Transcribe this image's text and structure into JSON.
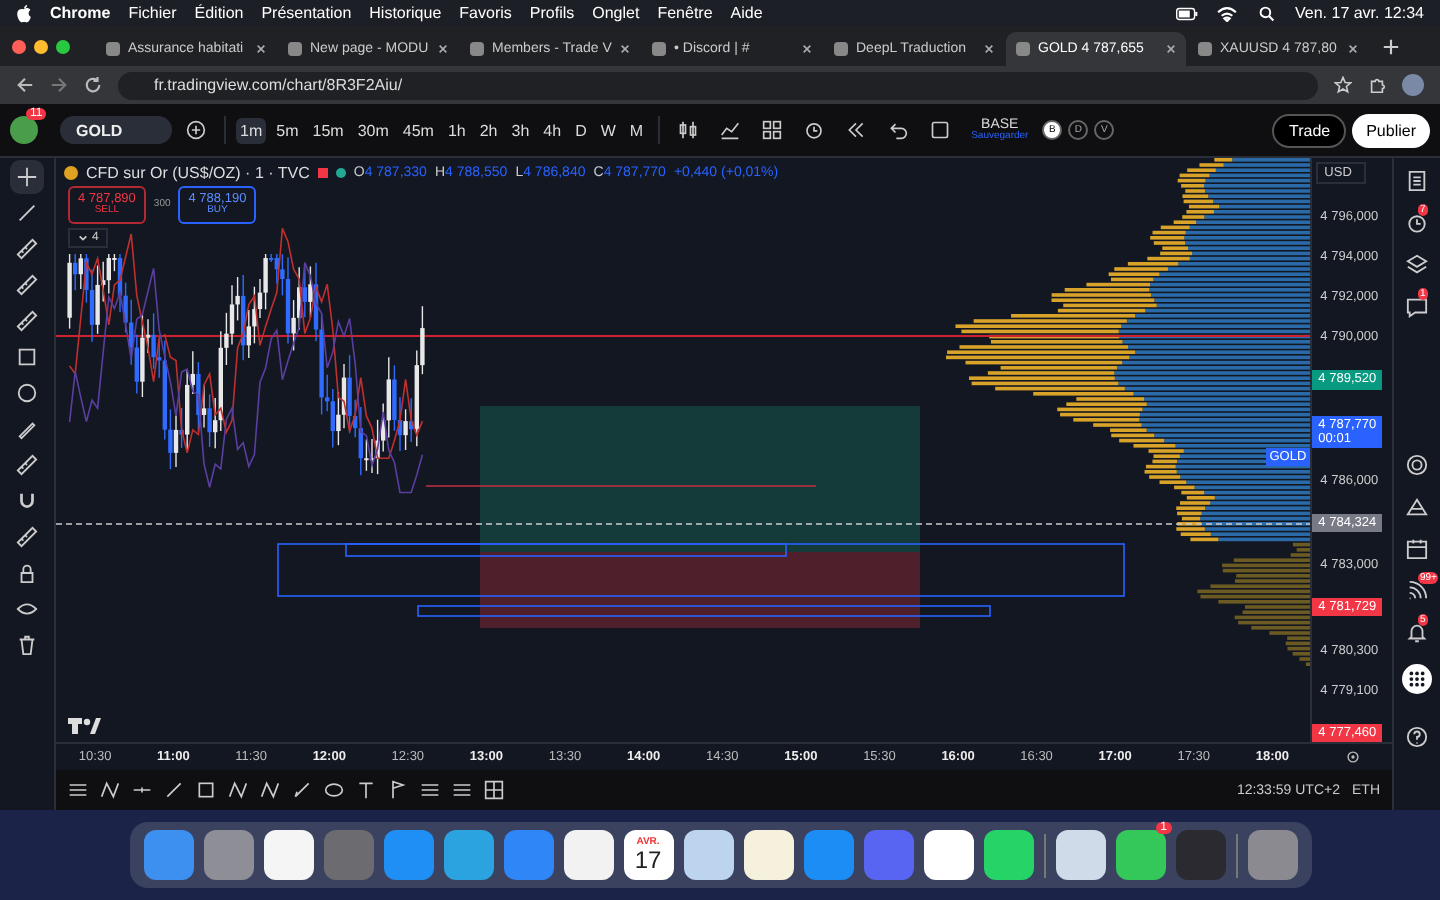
{
  "menu_bar": {
    "app": "Chrome",
    "items": [
      "Fichier",
      "Édition",
      "Présentation",
      "Historique",
      "Favoris",
      "Profils",
      "Onglet",
      "Fenêtre",
      "Aide"
    ],
    "clock": "Ven. 17 avr. 12:34"
  },
  "tabs": [
    {
      "title": "Assurance habitati",
      "selected": false
    },
    {
      "title": "New page - MODU",
      "selected": false
    },
    {
      "title": "Members - Trade V",
      "selected": false
    },
    {
      "title": "• Discord | #",
      "selected": false
    },
    {
      "title": "DeepL Traduction",
      "selected": false
    },
    {
      "title": "GOLD 4 787,655",
      "selected": true
    },
    {
      "title": "XAUUSD 4 787,80",
      "selected": false
    }
  ],
  "address": "fr.tradingview.com/chart/8R3F2Aiu/",
  "toolbar": {
    "avatar_badge": "11",
    "symbol": "GOLD",
    "intervals": [
      {
        "label": "1m",
        "selected": true
      },
      {
        "label": "5m",
        "selected": false
      },
      {
        "label": "15m",
        "selected": false
      },
      {
        "label": "30m",
        "selected": false
      },
      {
        "label": "45m",
        "selected": false
      },
      {
        "label": "1h",
        "selected": false
      },
      {
        "label": "2h",
        "selected": false
      },
      {
        "label": "3h",
        "selected": false
      },
      {
        "label": "4h",
        "selected": false
      },
      {
        "label": "D",
        "selected": false
      },
      {
        "label": "W",
        "selected": false
      },
      {
        "label": "M",
        "selected": false
      }
    ],
    "layout_name": "BASE",
    "layout_status": "Sauvegarder",
    "toggles": [
      "B",
      "D",
      "V"
    ],
    "trade": "Trade",
    "publish": "Publier"
  },
  "chart": {
    "title": "CFD sur Or (US$/OZ) · 1 · TVC",
    "ohlc": [
      {
        "label": "O",
        "value": "4 787,330"
      },
      {
        "label": "H",
        "value": "4 788,550"
      },
      {
        "label": "L",
        "value": "4 786,840"
      },
      {
        "label": "C",
        "value": "4 787,770"
      }
    ],
    "change": "+0,440 (+0,01%)",
    "sell": {
      "price": "4 787,890",
      "label": "SELL"
    },
    "spread": "300",
    "buy": {
      "price": "4 788,190",
      "label": "BUY"
    },
    "indicators": "4",
    "symbol_tag": "GOLD",
    "currency": "USD",
    "price_labels": [
      {
        "kind": "tick",
        "text": "4 796,000"
      },
      {
        "kind": "tick",
        "text": "4 794,000"
      },
      {
        "kind": "tick",
        "text": "4 792,000"
      },
      {
        "kind": "tick",
        "text": "4 790,000"
      },
      {
        "kind": "tag",
        "text": "4 789,520",
        "color": "#089981"
      },
      {
        "kind": "tag",
        "text": "4 787,770",
        "sub": "00:01",
        "color": "#2962ff"
      },
      {
        "kind": "tick",
        "text": "4 786,000"
      },
      {
        "kind": "tag",
        "text": "4 784,324",
        "color": "#787b86"
      },
      {
        "kind": "tick",
        "text": "4 783,000"
      },
      {
        "kind": "tag",
        "text": "4 781,729",
        "color": "#f23645"
      },
      {
        "kind": "tick",
        "text": "4 780,300"
      },
      {
        "kind": "tick",
        "text": "4 779,100"
      },
      {
        "kind": "tag",
        "text": "4 777,460",
        "color": "#f23645"
      }
    ],
    "time_ticks": [
      {
        "label": "10:30",
        "bold": false
      },
      {
        "label": "11:00",
        "bold": true
      },
      {
        "label": "11:30",
        "bold": false
      },
      {
        "label": "12:00",
        "bold": true
      },
      {
        "label": "12:30",
        "bold": false
      },
      {
        "label": "13:00",
        "bold": true
      },
      {
        "label": "13:30",
        "bold": false
      },
      {
        "label": "14:00",
        "bold": true
      },
      {
        "label": "14:30",
        "bold": false
      },
      {
        "label": "15:00",
        "bold": true
      },
      {
        "label": "15:30",
        "bold": false
      },
      {
        "label": "16:00",
        "bold": true
      },
      {
        "label": "16:30",
        "bold": false
      },
      {
        "label": "17:00",
        "bold": true
      },
      {
        "label": "17:30",
        "bold": false
      },
      {
        "label": "18:00",
        "bold": true
      }
    ],
    "clock": "12:33:59 UTC+2",
    "session": "ETH"
  },
  "sidebar": {
    "badges": [
      "7",
      "1",
      "99+",
      "5"
    ]
  },
  "dock": [
    {
      "kind": "app",
      "color": "#3d8ff0"
    },
    {
      "kind": "app",
      "color": "#8e8e96"
    },
    {
      "kind": "app",
      "color": "#f5f5f5"
    },
    {
      "kind": "app",
      "color": "#6b6b70"
    },
    {
      "kind": "app",
      "color": "#1f8ff5"
    },
    {
      "kind": "app",
      "color": "#2aa3e0"
    },
    {
      "kind": "app",
      "color": "#2f86f6"
    },
    {
      "kind": "app",
      "color": "#f2f2f2"
    },
    {
      "kind": "calendar",
      "month": "AVR.",
      "day": "17",
      "color": "#ffffff"
    },
    {
      "kind": "app",
      "color": "#bcd4ee"
    },
    {
      "kind": "app",
      "color": "#f6f1dc"
    },
    {
      "kind": "app",
      "color": "#1c8df5"
    },
    {
      "kind": "app",
      "color": "#5865f2"
    },
    {
      "kind": "app",
      "color": "#ffffff"
    },
    {
      "kind": "app",
      "color": "#25d366"
    },
    {
      "kind": "separator"
    },
    {
      "kind": "app",
      "color": "#cfdbe8"
    },
    {
      "kind": "app",
      "color": "#34c759",
      "badge": "1"
    },
    {
      "kind": "app",
      "color": "#2a2a30"
    },
    {
      "kind": "separator"
    },
    {
      "kind": "app",
      "color": "#8a8a90"
    }
  ]
}
